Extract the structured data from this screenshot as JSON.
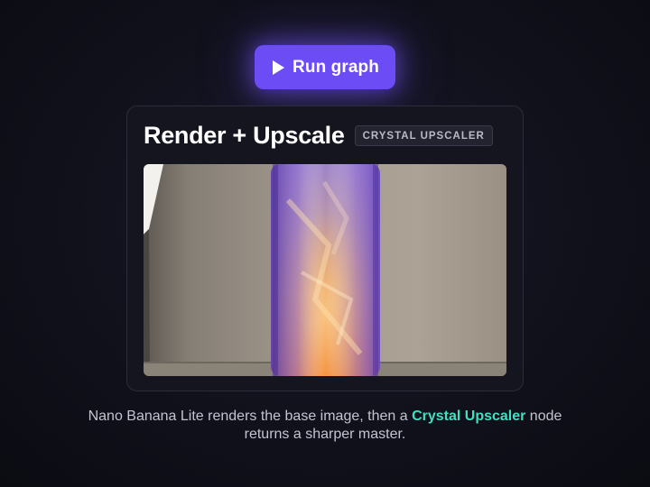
{
  "run_button": {
    "label": "Run graph",
    "icon": "play-icon",
    "color": "#6c4df5"
  },
  "card": {
    "title": "Render + Upscale",
    "badge": "CRYSTAL UPSCALER",
    "image": {
      "subject": "translucent-amber-violet-panel"
    }
  },
  "caption": {
    "before": "Nano Banana Lite renders the base image, then a ",
    "highlight": "Crystal Upscaler",
    "after": " node",
    "line2": "returns a sharper master.",
    "highlight_color": "#3ee0c0"
  }
}
